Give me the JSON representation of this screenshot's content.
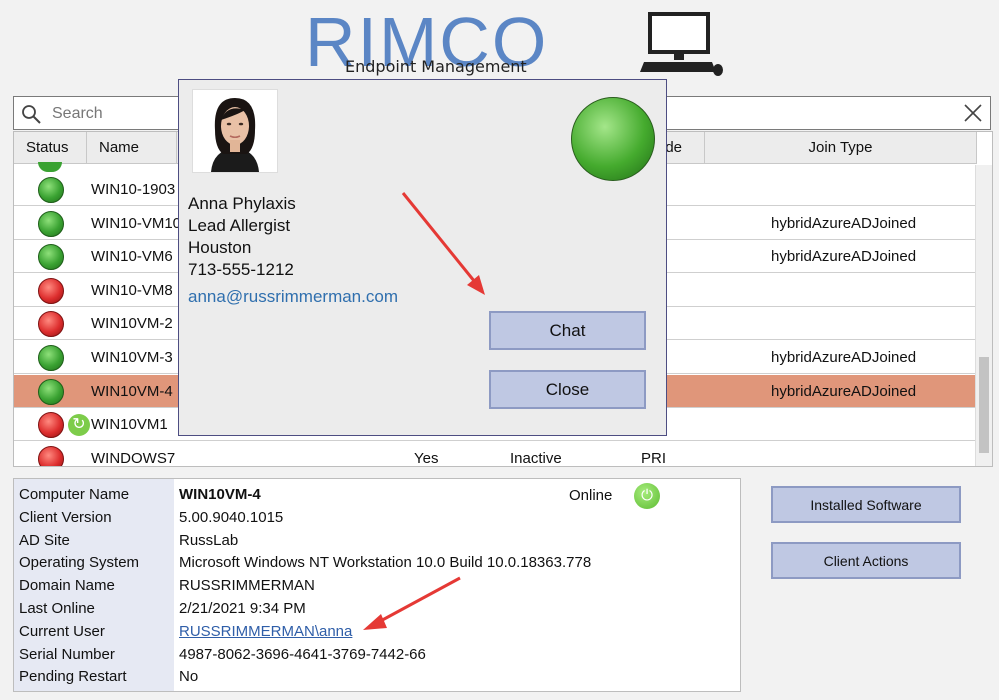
{
  "header": {
    "logo": "RIMCO",
    "subtitle": "Endpoint Management",
    "icon": "computer-icon"
  },
  "search": {
    "placeholder": "Search",
    "value": ""
  },
  "grid": {
    "columns": [
      "Status",
      "Name",
      "",
      "",
      "ode",
      "Join Type"
    ],
    "rows": [
      {
        "status": "green",
        "name": "WIN10-1903",
        "col3": "",
        "col4": "",
        "col5": "",
        "join": "",
        "selected": false
      },
      {
        "status": "green",
        "name": "WIN10-VM10",
        "col3": "",
        "col4": "",
        "col5": "",
        "join": "hybridAzureADJoined",
        "selected": false
      },
      {
        "status": "green",
        "name": "WIN10-VM6",
        "col3": "",
        "col4": "",
        "col5": "",
        "join": "hybridAzureADJoined",
        "selected": false
      },
      {
        "status": "red",
        "name": "WIN10-VM8",
        "col3": "",
        "col4": "",
        "col5": "",
        "join": "",
        "selected": false
      },
      {
        "status": "red",
        "name": "WIN10VM-2",
        "col3": "",
        "col4": "",
        "col5": "",
        "join": "",
        "selected": false
      },
      {
        "status": "green",
        "name": "WIN10VM-3",
        "col3": "",
        "col4": "",
        "col5": "",
        "join": "hybridAzureADJoined",
        "selected": false
      },
      {
        "status": "green",
        "name": "WIN10VM-4",
        "col3": "",
        "col4": "",
        "col5": "",
        "join": "hybridAzureADJoined",
        "selected": true
      },
      {
        "status": "red",
        "name": "WIN10VM1",
        "col3": "",
        "col4": "",
        "col5": "",
        "join": "",
        "selected": false,
        "refresh": true
      },
      {
        "status": "red",
        "name": "WINDOWS7",
        "col3": "Yes",
        "col4": "Inactive",
        "col5": "PRI",
        "join": "",
        "selected": false
      }
    ]
  },
  "details": {
    "online_label": "Online",
    "fields": [
      {
        "label": "Computer Name",
        "value": "WIN10VM-4",
        "style": "bold"
      },
      {
        "label": "Client Version",
        "value": "5.00.9040.1015",
        "style": ""
      },
      {
        "label": "AD Site",
        "value": "RussLab",
        "style": ""
      },
      {
        "label": "Operating System",
        "value": "Microsoft Windows NT Workstation 10.0 Build 10.0.18363.778",
        "style": ""
      },
      {
        "label": "Domain Name",
        "value": "RUSSRIMMERMAN",
        "style": ""
      },
      {
        "label": "Last Online",
        "value": "2/21/2021 9:34 PM",
        "style": ""
      },
      {
        "label": "Current User",
        "value": "RUSSRIMMERMAN\\anna",
        "style": "link"
      },
      {
        "label": "Serial Number",
        "value": "4987-8062-3696-4641-3769-7442-66",
        "style": ""
      },
      {
        "label": "Pending Restart",
        "value": "No",
        "style": ""
      }
    ]
  },
  "actions": {
    "installed_software": "Installed Software",
    "client_actions": "Client Actions"
  },
  "modal": {
    "name": "Anna Phylaxis",
    "title": "Lead Allergist",
    "city": "Houston",
    "phone": "713-555-1212",
    "email": "anna@russrimmerman.com",
    "chat_label": "Chat",
    "close_label": "Close"
  },
  "colors": {
    "accent": "#5b86c5",
    "selected_row": "#e0967a",
    "button": "#bfc8e3",
    "arrow": "#e53935"
  }
}
